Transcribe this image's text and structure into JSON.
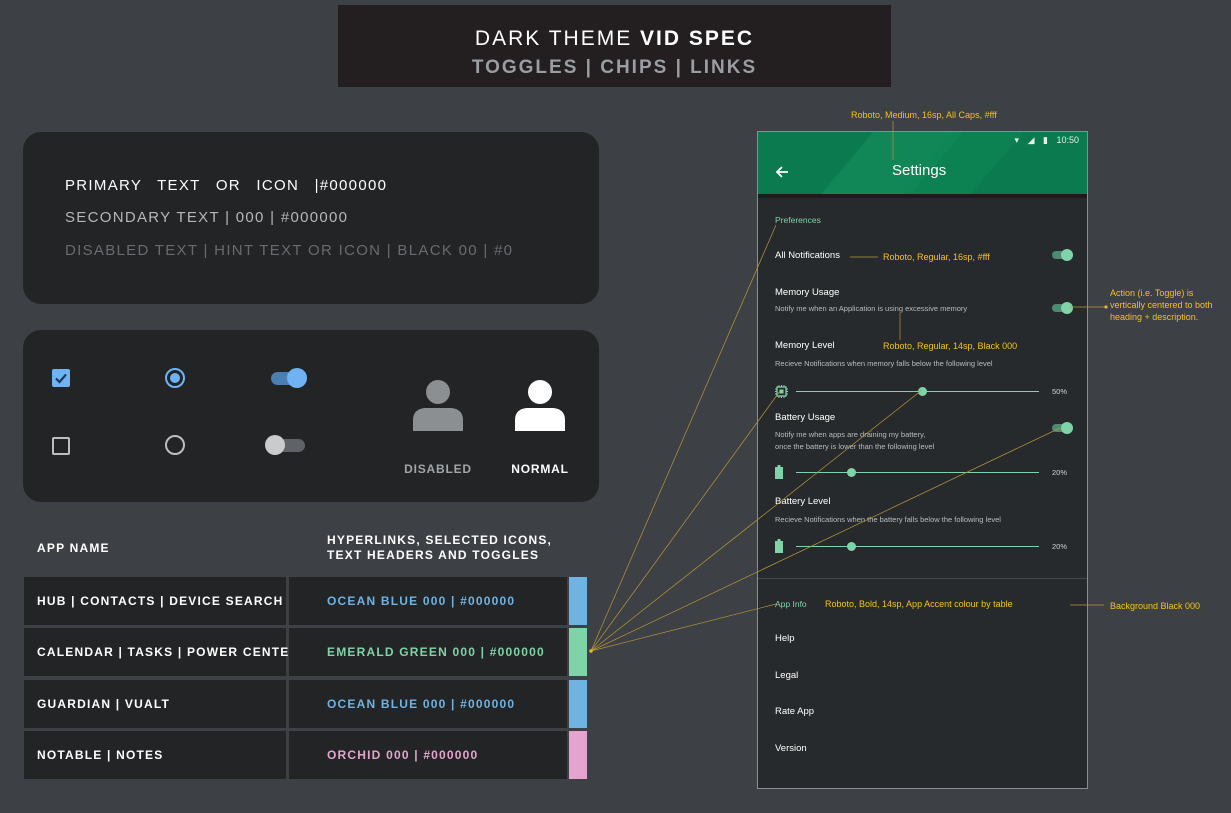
{
  "banner": {
    "title_light": "DARK THEME ",
    "title_bold": "VID SPEC",
    "subtitle": "TOGGLES | CHIPS | LINKS"
  },
  "text_levels": {
    "primary": "PRIMARY TEXT OR ICON |#000000",
    "secondary": "SECONDARY TEXT | 000 | #000000",
    "disabled": "DISABLED TEXT | HINT TEXT OR ICON | BLACK 00 | #0"
  },
  "controls": {
    "accent": "#6fb3f5",
    "disabled_label": "DISABLED",
    "normal_label": "NORMAL"
  },
  "table": {
    "header_app": "APP NAME",
    "header_links_1": "HYPERLINKS, SELECTED ICONS,",
    "header_links_2": "TEXT HEADERS AND TOGGLES",
    "rows": [
      {
        "app": "HUB | CONTACTS | DEVICE SEARCH",
        "color_label": "OCEAN BLUE 000 | #000000",
        "color": "#6fb3e3"
      },
      {
        "app": "CALENDAR | TASKS | POWER CENTER",
        "color_label": "EMERALD GREEN 000 | #000000",
        "color": "#7fd3a8"
      },
      {
        "app": "GUARDIAN | VUALT",
        "color_label": "OCEAN BLUE 000 | #000000",
        "color": "#6fb3e3"
      },
      {
        "app": "NOTABLE | NOTES",
        "color_label": "ORCHID 000 | #000000",
        "color": "#e5a4cf"
      }
    ]
  },
  "phone": {
    "status_time": "10:50",
    "title": "Settings",
    "preferences_header": "Preferences",
    "all_notifications": "All Notifications",
    "memory_usage": "Memory Usage",
    "memory_usage_desc": "Notify me when an Application is using excessive memory",
    "memory_level": "Memory Level",
    "memory_level_desc": "Recieve Notifications when memory falls below the following level",
    "memory_slider_value": "50%",
    "battery_usage": "Battery Usage",
    "battery_usage_desc_1": "Notify me when apps are draining my battery,",
    "battery_usage_desc_2": "once the battery is lower than the following level",
    "battery_usage_slider_value": "20%",
    "battery_level": "Battery Level",
    "battery_level_desc": "Recieve Notifications when the battery falls below the following level",
    "battery_level_slider_value": "20%",
    "app_info_header": "App Info",
    "help": "Help",
    "legal": "Legal",
    "rate_app": "Rate App",
    "version": "Version",
    "memory_slider_fraction": 0.52,
    "battery_usage_slider_fraction": 0.23,
    "battery_level_slider_fraction": 0.23
  },
  "annotations": {
    "appbar_title": "Roboto, Medium, 16sp, All Caps, #fff",
    "item_title": "Roboto, Regular, 16sp, #fff",
    "action_1": "Action (i.e. Toggle) is",
    "action_2": "vertically centered to both",
    "action_3": "heading + description.",
    "item_desc": "Roboto, Regular, 14sp, Black 000",
    "section_header": "Roboto, Bold, 14sp, App Accent colour by table",
    "background": "Background Black 000"
  }
}
